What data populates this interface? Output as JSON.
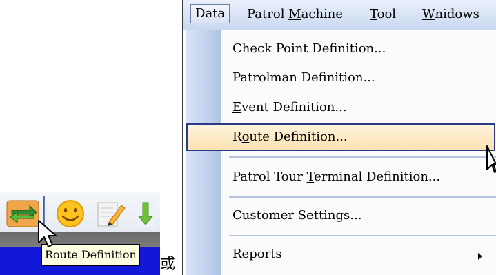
{
  "tooltip": "Route Definition",
  "or_text": "或",
  "toolbar": {
    "buttons": [
      {
        "name": "route-definition-button",
        "icon": "route-arrows-icon"
      },
      {
        "name": "patrolman-button",
        "icon": "smiley-icon"
      },
      {
        "name": "event-button",
        "icon": "pencil-note-icon"
      },
      {
        "name": "download-button",
        "icon": "green-down-arrow-icon"
      }
    ]
  },
  "menubar": {
    "items": [
      {
        "label": "Data",
        "ul": "D",
        "rest": "ata"
      },
      {
        "label": "Patrol Machine",
        "pre": "Patrol ",
        "ul": "M",
        "rest": "achine"
      },
      {
        "label": "Tool",
        "ul": "T",
        "rest": "ool"
      },
      {
        "label": "Wnidows",
        "ul": "W",
        "rest": "nidows"
      }
    ]
  },
  "menu": {
    "items": [
      {
        "label": "Check Point Definition...",
        "pre": "",
        "ul": "C",
        "rest": "heck Point Definition..."
      },
      {
        "label": "Patrolman Definition...",
        "pre": "Patrol",
        "ul": "m",
        "rest": "an Definition..."
      },
      {
        "label": "Event Definition...",
        "pre": "",
        "ul": "E",
        "rest": "vent Definition..."
      },
      {
        "label": "Route Definition...",
        "pre": "R",
        "ul": "o",
        "rest": "ute Definition..."
      },
      {
        "label": "Patrol Tour Terminal Definition...",
        "pre": "Patrol Tour ",
        "ul": "T",
        "rest": "erminal Definition..."
      },
      {
        "label": "Customer Settings...",
        "pre": "C",
        "ul": "u",
        "rest": "stomer Settings..."
      },
      {
        "label": "Reports",
        "pre": "",
        "ul": "",
        "rest": "Reports"
      }
    ]
  },
  "colors": {
    "highlight": "#fbe2b2",
    "gutter": "#aec4e6",
    "taskbar": "#1218d8",
    "tooltip_bg": "#ffffe1"
  }
}
